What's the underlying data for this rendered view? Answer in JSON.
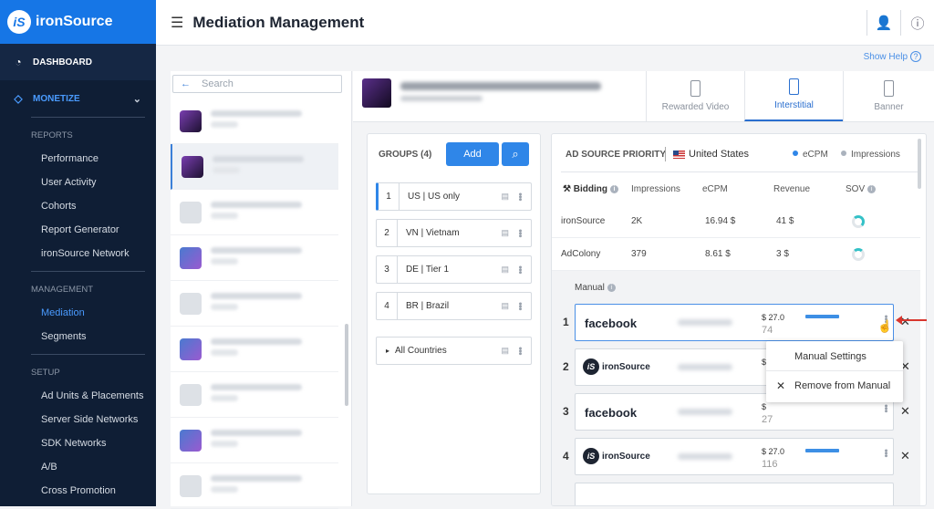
{
  "brand": {
    "logo_letter": "iS",
    "name": "ironSource"
  },
  "sidebar": {
    "dashboard": "DASHBOARD",
    "monetize": "MONETIZE",
    "reports_title": "REPORTS",
    "reports": [
      "Performance",
      "User Activity",
      "Cohorts",
      "Report Generator",
      "ironSource Network"
    ],
    "management_title": "MANAGEMENT",
    "management": [
      "Mediation",
      "Segments"
    ],
    "setup_title": "SETUP",
    "setup": [
      "Ad Units & Placements",
      "Server Side Networks",
      "SDK Networks",
      "A/B",
      "Cross Promotion"
    ]
  },
  "header": {
    "title": "Mediation Management",
    "show_help": "Show Help"
  },
  "search": {
    "placeholder": "Search"
  },
  "tabs": [
    "Rewarded Video",
    "Interstitial",
    "Banner"
  ],
  "groups": {
    "title": "GROUPS (4)",
    "add_label": "Add",
    "items": [
      {
        "num": "1",
        "name": "US | US only"
      },
      {
        "num": "2",
        "name": "VN | Vietnam"
      },
      {
        "num": "3",
        "name": "DE | Tier 1"
      },
      {
        "num": "4",
        "name": "BR | Brazil"
      }
    ],
    "all_countries": "All Countries"
  },
  "priority": {
    "title": "AD SOURCE PRIORITY",
    "country": "United States",
    "legend": [
      "eCPM",
      "Impressions"
    ],
    "columns": [
      "Bidding",
      "Impressions",
      "eCPM",
      "Revenue",
      "SOV"
    ],
    "bidding_rows": [
      {
        "network": "ironSource",
        "impressions": "2K",
        "ecpm": "16.94 $",
        "revenue": "41 $"
      },
      {
        "network": "AdColony",
        "impressions": "379",
        "ecpm": "8.61 $",
        "revenue": "3 $"
      }
    ],
    "manual_label": "Manual",
    "manual_rows": [
      {
        "rank": "1",
        "network": "facebook",
        "price": "$ 27.0",
        "count": "74"
      },
      {
        "rank": "2",
        "network": "ironSource",
        "price": "$",
        "count": ""
      },
      {
        "rank": "3",
        "network": "facebook",
        "price": "$",
        "count": "27"
      },
      {
        "rank": "4",
        "network": "ironSource",
        "price": "$ 27.0",
        "count": "116"
      }
    ]
  },
  "context_menu": {
    "settings": "Manual Settings",
    "remove": "Remove from Manual"
  },
  "colors": {
    "accent": "#2f86e8",
    "sidebar_bg": "#0f1e35",
    "logo_bg": "#1676e6",
    "sov_color": "#34c1c7",
    "arrow": "#d8362e"
  }
}
